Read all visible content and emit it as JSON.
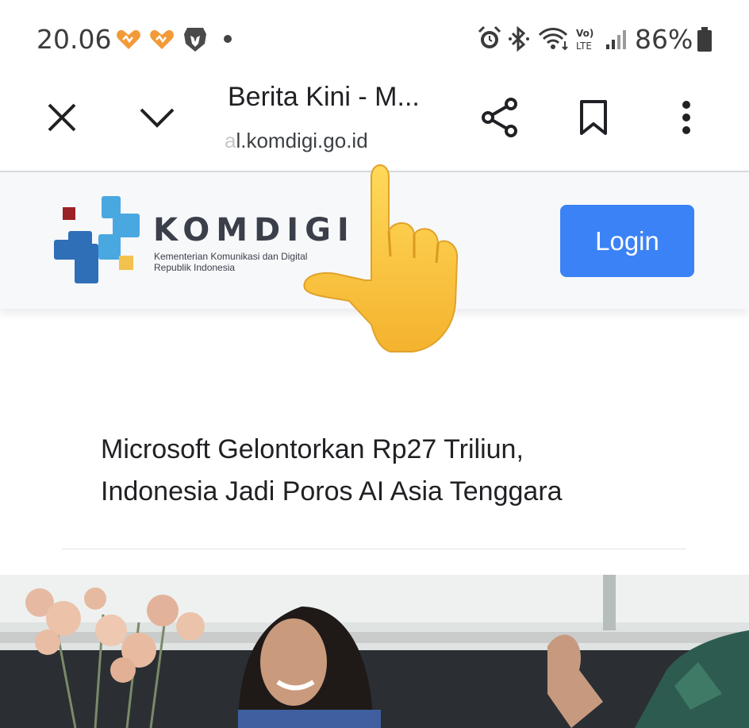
{
  "status_bar": {
    "time": "20.06",
    "battery": "86%",
    "network": "LTE",
    "icons": [
      "heart-icon",
      "heart-icon",
      "brave-lion-icon",
      "alarm-icon",
      "bluetooth-icon",
      "wifi-icon",
      "volte-icon",
      "signal-icon",
      "battery-icon"
    ]
  },
  "toolbar": {
    "title": "Berita Kini - M...",
    "url_faded": "a",
    "url_main": "l.komdigi.go.id",
    "icons": [
      "close-icon",
      "chevron-down-icon",
      "share-icon",
      "bookmark-icon",
      "more-vert-icon"
    ]
  },
  "site_header": {
    "logo_word": "KOMDIGI",
    "logo_sub1": "Kementerian Komunikasi dan Digital",
    "logo_sub2": "Republik Indonesia",
    "login_label": "Login",
    "colors": {
      "login": "#3b82f6",
      "logo_blue": "#2f6fb8",
      "logo_light": "#4aa8e0",
      "logo_red": "#9b2226",
      "logo_yellow": "#f2c14e"
    }
  },
  "article": {
    "headline_line1": "Microsoft Gelontorkan Rp27 Triliun,",
    "headline_line2": "Indonesia Jadi Poros AI Asia Tenggara"
  },
  "overlay": {
    "icon": "pointing-hand-icon"
  }
}
